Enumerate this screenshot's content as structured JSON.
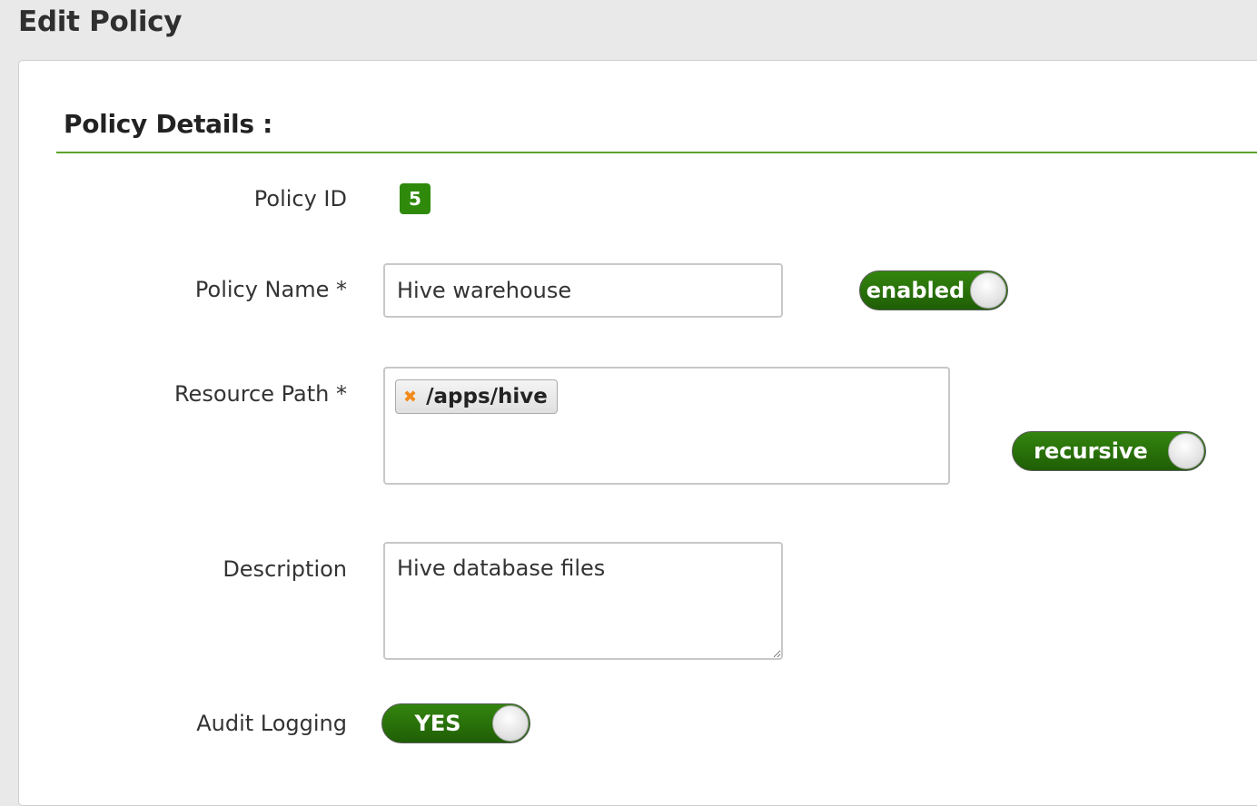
{
  "header": {
    "title": "Edit Policy"
  },
  "section": {
    "title": "Policy Details :"
  },
  "form": {
    "policy_id": {
      "label": "Policy ID",
      "value": "5"
    },
    "policy_name": {
      "label": "Policy Name *",
      "value": "Hive warehouse",
      "toggle_label": "enabled",
      "toggle_on": true
    },
    "resource_path": {
      "label": "Resource Path *",
      "tags": [
        "/apps/hive"
      ],
      "remove_glyph": "✖",
      "toggle_label": "recursive",
      "toggle_on": true
    },
    "description": {
      "label": "Description",
      "value": "Hive database files"
    },
    "audit_logging": {
      "label": "Audit Logging",
      "toggle_label": "YES",
      "toggle_on": true
    }
  },
  "colors": {
    "accent_green": "#2f8a0c",
    "toggle_green": "#2a7a0a",
    "section_rule": "#5ea32a",
    "tag_remove": "#f28a1c"
  },
  "icons": {
    "tag_remove": "close-icon"
  }
}
